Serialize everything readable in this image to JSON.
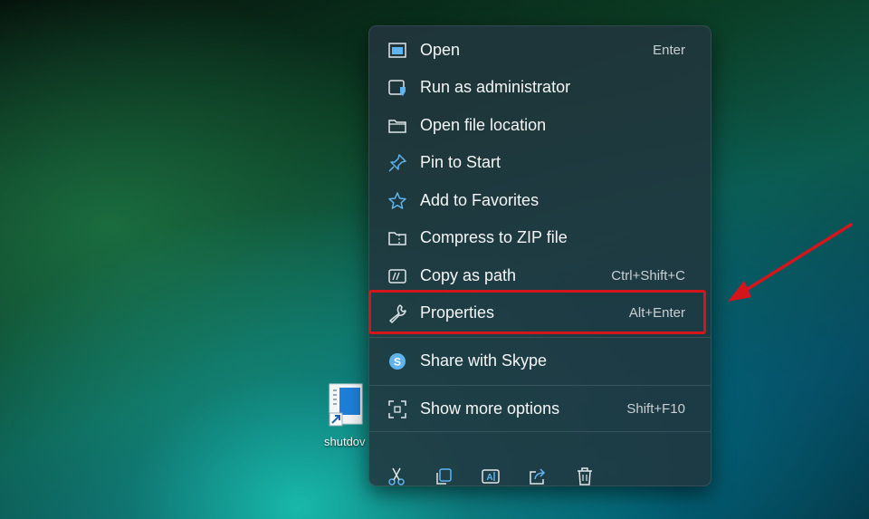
{
  "desktop": {
    "shortcut_label": "shutdov"
  },
  "context_menu": {
    "items": [
      {
        "label": "Open",
        "shortcut": "Enter",
        "icon": "open-window-icon"
      },
      {
        "label": "Run as administrator",
        "shortcut": "",
        "icon": "admin-shield-icon"
      },
      {
        "label": "Open file location",
        "shortcut": "",
        "icon": "folder-icon"
      },
      {
        "label": "Pin to Start",
        "shortcut": "",
        "icon": "pin-icon"
      },
      {
        "label": "Add to Favorites",
        "shortcut": "",
        "icon": "star-icon"
      },
      {
        "label": "Compress to ZIP file",
        "shortcut": "",
        "icon": "zip-folder-icon"
      },
      {
        "label": "Copy as path",
        "shortcut": "Ctrl+Shift+C",
        "icon": "copy-path-icon"
      },
      {
        "label": "Properties",
        "shortcut": "Alt+Enter",
        "icon": "wrench-icon"
      },
      {
        "label": "Share with Skype",
        "shortcut": "",
        "icon": "skype-icon"
      },
      {
        "label": "Show more options",
        "shortcut": "Shift+F10",
        "icon": "more-options-icon"
      }
    ],
    "toolbar": [
      {
        "icon": "cut-icon"
      },
      {
        "icon": "copy-icon"
      },
      {
        "icon": "rename-icon"
      },
      {
        "icon": "share-icon"
      },
      {
        "icon": "delete-icon"
      }
    ]
  },
  "annotation": {
    "highlight_color": "#d4161c",
    "arrow_color": "#d4161c"
  },
  "colors": {
    "icon_accent": "#5fb4f0",
    "menu_text": "#f4f6f7"
  }
}
